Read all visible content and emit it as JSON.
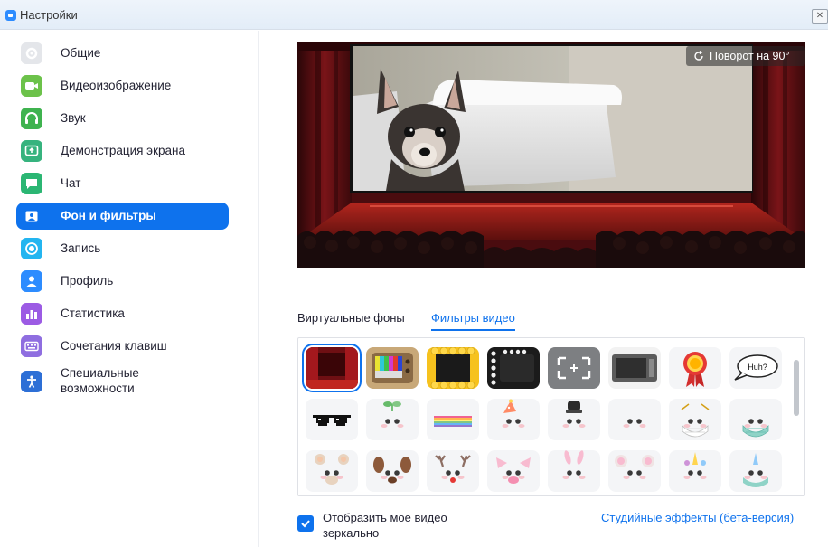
{
  "window": {
    "title": "Настройки",
    "close_symbol": "✕"
  },
  "sidebar": {
    "items": [
      {
        "label": "Общие",
        "icon": "gear-icon",
        "color": "#e4e6ea"
      },
      {
        "label": "Видеоизображение",
        "icon": "video-camera-icon",
        "color": "#6cc24a"
      },
      {
        "label": "Звук",
        "icon": "headphones-icon",
        "color": "#3fb34f"
      },
      {
        "label": "Демонстрация экрана",
        "icon": "share-screen-icon",
        "color": "#36b37e"
      },
      {
        "label": "Чат",
        "icon": "chat-bubble-icon",
        "color": "#2bb673"
      },
      {
        "label": "Фон и фильтры",
        "icon": "background-icon",
        "color": "#0e72ed",
        "active": true
      },
      {
        "label": "Запись",
        "icon": "record-icon",
        "color": "#23b5f0"
      },
      {
        "label": "Профиль",
        "icon": "profile-icon",
        "color": "#2d8cff"
      },
      {
        "label": "Статистика",
        "icon": "statistics-icon",
        "color": "#9c5be4"
      },
      {
        "label": "Сочетания клавиш",
        "icon": "keyboard-icon",
        "color": "#8f6ee0"
      },
      {
        "label": "Специальные возможности",
        "icon": "accessibility-icon",
        "color": "#2d6fd6"
      }
    ]
  },
  "preview": {
    "rotate_label": "Поворот на 90°"
  },
  "tabs": {
    "virtual_backgrounds": "Виртуальные фоны",
    "video_filters": "Фильтры видео"
  },
  "filters": {
    "selected_index": 0,
    "tiles": [
      "theater-curtain",
      "retro-tv",
      "emoji-frame",
      "film-strip",
      "focus-frame",
      "microwave",
      "ribbon-medal",
      "huh-speech-bubble",
      "pixel-sunglasses",
      "sprout-face",
      "rainbow-face",
      "party-hat-face",
      "chef-hat-face",
      "cute-face",
      "face-mask-white",
      "face-mask-teal",
      "bear-ears",
      "puppy-ears",
      "reindeer-antlers",
      "pig-ears",
      "bunny-ears",
      "mouse-ears",
      "unicorn-horn",
      "unicorn-mask"
    ],
    "bubble_text": "Huh?"
  },
  "mirror": {
    "label": "Отобразить мое видео зеркально",
    "checked": true
  },
  "studio_link": "Студийные эффекты (бета-версия)"
}
